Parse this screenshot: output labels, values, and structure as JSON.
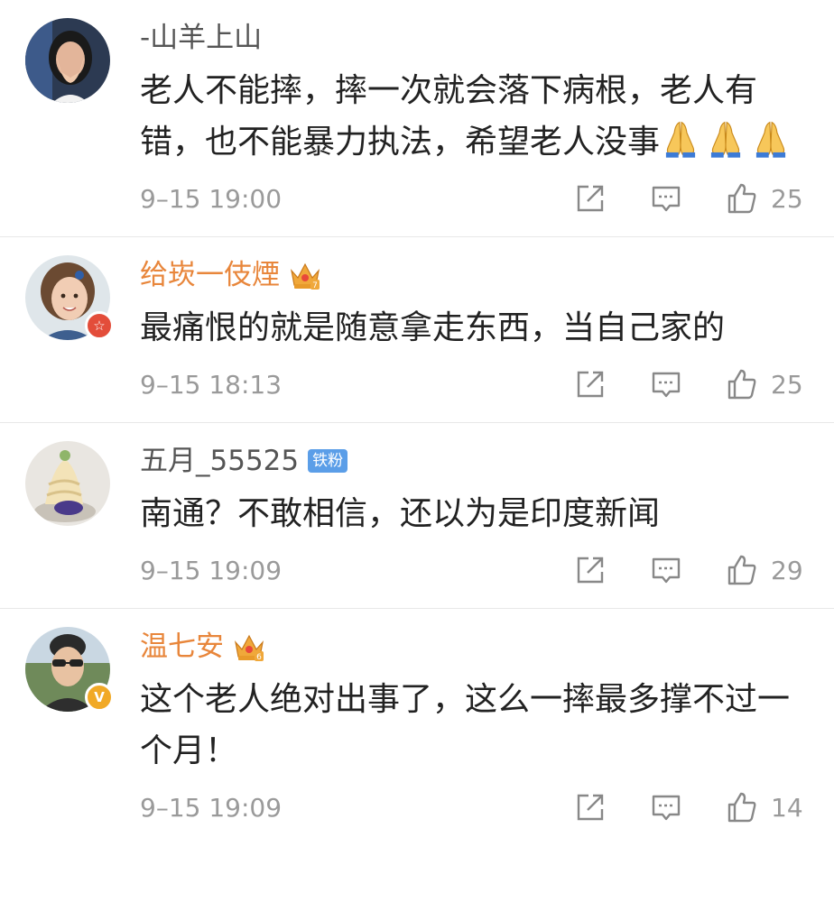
{
  "comments": [
    {
      "username": "-山羊上山",
      "text_before_emoji": "老人不能摔，摔一次就会落下病根，老人有错，也不能暴力执法，希望老人没事",
      "emoji": "folded-hands-icon",
      "emoji_count": 3,
      "time": "9–15 19:00",
      "likes": "25"
    },
    {
      "username": "给崁一伎煙",
      "text": "最痛恨的就是随意拿走东西，当自己家的",
      "time": "9–15 18:13",
      "likes": "25"
    },
    {
      "username": "五月_55525",
      "tag": "铁粉",
      "text": "南通？不敢相信，还以为是印度新闻",
      "time": "9–15 19:09",
      "likes": "29"
    },
    {
      "username": "温七安",
      "text": "这个老人绝对出事了，这么一摔最多撑不过一个月！",
      "time": "9–15 19:09",
      "likes": "14"
    }
  ],
  "colors": {
    "username_default": "#555555",
    "username_vip": "#e8863b",
    "timestamp": "#9a9a9a",
    "fan_tag": "#5b9ee8",
    "divider": "#e8e8e8"
  }
}
